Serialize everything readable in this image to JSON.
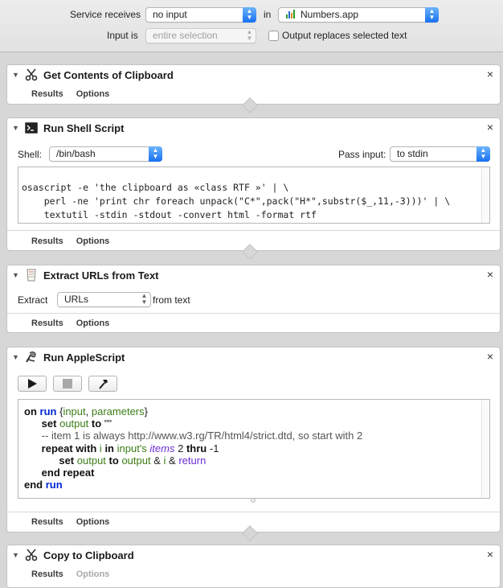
{
  "header": {
    "service_receives_label": "Service receives",
    "service_receives_value": "no input",
    "in_label": "in",
    "app_value": "Numbers.app",
    "input_is_label": "Input is",
    "input_is_value": "entire selection",
    "output_replaces_label": "Output replaces selected text"
  },
  "actions": [
    {
      "title": "Get Contents of Clipboard",
      "icon": "scissors-icon",
      "tabs": [
        "Results",
        "Options"
      ]
    },
    {
      "title": "Run Shell Script",
      "icon": "terminal-icon",
      "shell_label": "Shell:",
      "shell_value": "/bin/bash",
      "pass_input_label": "Pass input:",
      "pass_input_value": "to stdin",
      "code": [
        "osascript -e 'the clipboard as «class RTF »' | \\",
        "    perl -ne 'print chr foreach unpack(\"C*\",pack(\"H*\",substr($_,11,-3)))' | \\",
        "    textutil -stdin -stdout -convert html -format rtf"
      ],
      "tabs": [
        "Results",
        "Options"
      ]
    },
    {
      "title": "Extract URLs from Text",
      "icon": "text-document-icon",
      "extract_label": "Extract",
      "extract_value": "URLs",
      "from_text_label": "from text",
      "tabs": [
        "Results",
        "Options"
      ]
    },
    {
      "title": "Run AppleScript",
      "icon": "applescript-icon",
      "toolbar": [
        "run-icon",
        "stop-icon",
        "compile-icon"
      ],
      "code": {
        "l1_on": "on",
        "l1_run": "run",
        "l1_open": " {",
        "l1_input": "input",
        "l1_comma": ", ",
        "l1_parameters": "parameters",
        "l1_close": "}",
        "l2_set": "set",
        "l2_output": "output",
        "l2_to": "to",
        "l2_str": "\"\"",
        "l3_comment": "-- item 1 is always http://www.w3.rg/TR/html4/strict.dtd, so start with 2",
        "l4_repeat": "repeat with",
        "l4_i": "i",
        "l4_in": "in",
        "l4_input": "input's",
        "l4_items": "items",
        "l4_two": "2",
        "l4_thru": "thru",
        "l4_neg": "-1",
        "l5_set": "set",
        "l5_output": "output",
        "l5_to": "to",
        "l5_output2": "output",
        "l5_amp1": "&",
        "l5_i": "i",
        "l5_amp2": "&",
        "l5_return": "return",
        "l6_end": "end repeat",
        "l7_end": "end",
        "l7_run": "run"
      },
      "tabs": [
        "Results",
        "Options"
      ]
    },
    {
      "title": "Copy to Clipboard",
      "icon": "scissors-icon",
      "tabs": [
        "Results",
        "Options"
      ]
    }
  ],
  "close_glyph": "×",
  "collapse_glyph": "▼",
  "accent_color": "#1770f2"
}
